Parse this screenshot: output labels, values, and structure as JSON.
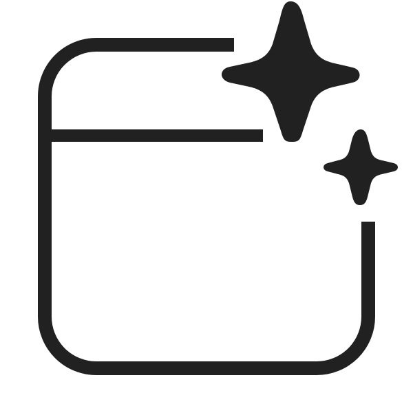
{
  "icon": {
    "name": "window-sparkle-icon",
    "color": "#212121",
    "background": "#ffffff"
  }
}
